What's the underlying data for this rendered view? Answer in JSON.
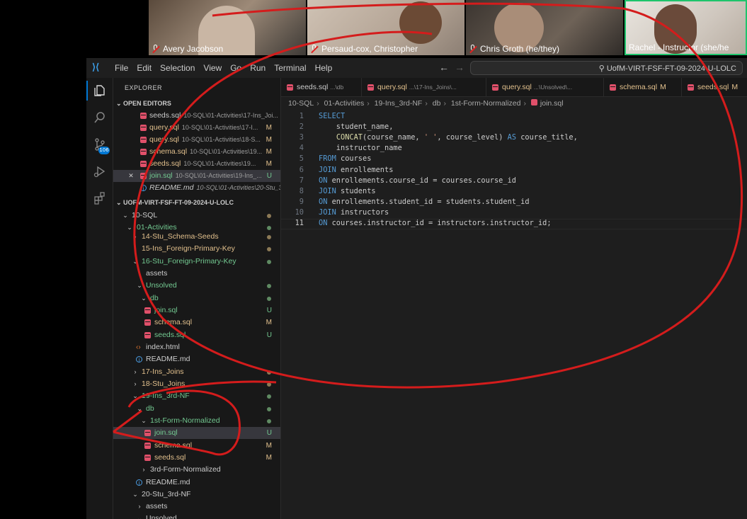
{
  "participants": [
    {
      "name": "Avery Jacobson"
    },
    {
      "name": "Persaud-cox, Christopher"
    },
    {
      "name": "Chris Groth (he/they)"
    },
    {
      "name": "Rachel - Instructor (she/he"
    }
  ],
  "menu": [
    "File",
    "Edit",
    "Selection",
    "View",
    "Go",
    "Run",
    "Terminal",
    "Help"
  ],
  "search": {
    "text": "UofM-VIRT-FSF-FT-09-2024-U-LOLC"
  },
  "activity": {
    "scm_badge": "106"
  },
  "explorer": {
    "title": "EXPLORER",
    "open_editors_title": "OPEN EDITORS",
    "open_editors": [
      {
        "name": "seeds.sql",
        "path": "10-SQL\\01-Activities\\17-Ins_Joi...",
        "status": ""
      },
      {
        "name": "query.sql",
        "path": "10-SQL\\01-Activities\\17-I...",
        "status": "M"
      },
      {
        "name": "query.sql",
        "path": "10-SQL\\01-Activities\\18-S...",
        "status": "M"
      },
      {
        "name": "schema.sql",
        "path": "10-SQL\\01-Activities\\19...",
        "status": "M"
      },
      {
        "name": "seeds.sql",
        "path": "10-SQL\\01-Activities\\19...",
        "status": "M"
      },
      {
        "name": "join.sql",
        "path": "10-SQL\\01-Activities\\19-Ins_...",
        "status": "U"
      },
      {
        "name": "README.md",
        "path": "10-SQL\\01-Activities\\20-Stu_3...",
        "status": ""
      }
    ],
    "workspace_title": "UOFM-VIRT-FSF-FT-09-2024-U-LOLC",
    "tree": [
      {
        "name": "10-SQL"
      },
      {
        "name": "01-Activities"
      },
      {
        "name": "14-Stu_Schema-Seeds"
      },
      {
        "name": "15-Ins_Foreign-Primary-Key"
      },
      {
        "name": "16-Stu_Foreign-Primary-Key"
      },
      {
        "name": "assets"
      },
      {
        "name": "Unsolved"
      },
      {
        "name": "db"
      },
      {
        "name": "join.sql",
        "status": "U"
      },
      {
        "name": "schema.sql",
        "status": "M"
      },
      {
        "name": "seeds.sql",
        "status": "U"
      },
      {
        "name": "index.html"
      },
      {
        "name": "README.md"
      },
      {
        "name": "17-Ins_Joins"
      },
      {
        "name": "18-Stu_Joins"
      },
      {
        "name": "19-Ins_3rd-NF"
      },
      {
        "name": "db"
      },
      {
        "name": "1st-Form-Normalized"
      },
      {
        "name": "join.sql",
        "status": "U"
      },
      {
        "name": "schema.sql",
        "status": "M"
      },
      {
        "name": "seeds.sql",
        "status": "M"
      },
      {
        "name": "3rd-Form-Normalized"
      },
      {
        "name": "README.md"
      },
      {
        "name": "20-Stu_3rd-NF"
      },
      {
        "name": "assets"
      },
      {
        "name": "Unsolved"
      }
    ]
  },
  "tabs": [
    {
      "name": "seeds.sql",
      "path": "...\\db",
      "mark": ""
    },
    {
      "name": "query.sql",
      "path": "...\\17-Ins_Joins\\...",
      "mark": ""
    },
    {
      "name": "query.sql",
      "path": "...\\Unsolved\\...",
      "mark": ""
    },
    {
      "name": "schema.sql",
      "path": "",
      "mark": "M"
    },
    {
      "name": "seeds.sql",
      "path": "",
      "mark": "M"
    }
  ],
  "breadcrumb": [
    "10-SQL",
    "01-Activities",
    "19-Ins_3rd-NF",
    "db",
    "1st-Form-Normalized",
    "join.sql"
  ],
  "code": {
    "line_numbers": [
      "1",
      "2",
      "3",
      "4",
      "5",
      "6",
      "7",
      "8",
      "9",
      "10",
      "11"
    ],
    "current_line": "11",
    "lines": [
      [
        {
          "t": "SELECT",
          "c": "kw"
        }
      ],
      [
        {
          "t": "    student_name,",
          "c": "id"
        }
      ],
      [
        {
          "t": "    ",
          "c": "id"
        },
        {
          "t": "CONCAT",
          "c": "fn"
        },
        {
          "t": "(course_name, ",
          "c": "id"
        },
        {
          "t": "' '",
          "c": "str"
        },
        {
          "t": ", course_level) ",
          "c": "id"
        },
        {
          "t": "AS",
          "c": "kw"
        },
        {
          "t": " course_title,",
          "c": "id"
        }
      ],
      [
        {
          "t": "    instructor_name",
          "c": "id"
        }
      ],
      [
        {
          "t": "FROM",
          "c": "kw"
        },
        {
          "t": " courses",
          "c": "id"
        }
      ],
      [
        {
          "t": "JOIN",
          "c": "kw"
        },
        {
          "t": " enrollements",
          "c": "id"
        }
      ],
      [
        {
          "t": "ON",
          "c": "kw"
        },
        {
          "t": " enrollements.course_id = courses.course_id",
          "c": "id"
        }
      ],
      [
        {
          "t": "JOIN",
          "c": "kw"
        },
        {
          "t": " students",
          "c": "id"
        }
      ],
      [
        {
          "t": "ON",
          "c": "kw"
        },
        {
          "t": " enrollements.student_id = students.student_id",
          "c": "id"
        }
      ],
      [
        {
          "t": "JOIN",
          "c": "kw"
        },
        {
          "t": " instructors",
          "c": "id"
        }
      ],
      [
        {
          "t": "ON",
          "c": "kw"
        },
        {
          "t": " courses.instructor_id = instructors.instructor_id;",
          "c": "id"
        }
      ]
    ]
  }
}
